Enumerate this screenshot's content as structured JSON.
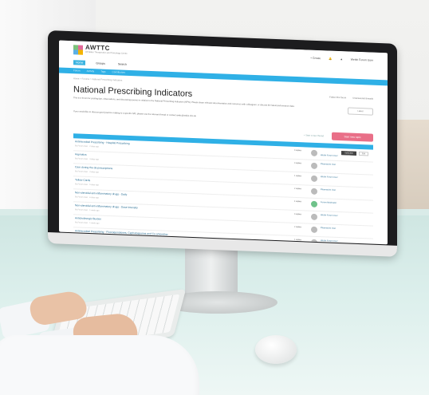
{
  "site": {
    "brand": "AWTTC",
    "brand_sub": "All Wales Therapeutics and Toxicology Centre",
    "nav": [
      "Home",
      "Groups",
      "Search"
    ],
    "header_right": [
      "+ Create",
      "Welsh Forum User"
    ],
    "subnav": [
      "Forum",
      "Activity",
      "Tags",
      "Contributors"
    ],
    "breadcrumb": "Home > Forums > National Prescribing Indicators",
    "page_title": "National Prescribing Indicators",
    "description": "This is a forum for posting tips, observations, and discussing queries in relation to the National Prescribing Indicators (NPIs). Please share relevant documentation and resources with colleagues, or discuss the latest performance data.",
    "description2": "If you would like to discuss good practice relating to a specific NPI, please use the relevant thread or contact awttc@wales.nhs.uk",
    "top_links": [
      "Follow this forum",
      "Unanswered threads"
    ],
    "sort_label": "Latest",
    "post_link": "+ Start a new thread",
    "start_button": "Start new topic",
    "threads": [
      {
        "title": "Antimicrobial Prescribing - Hospital Prescribing",
        "meta": "By Forum User · 2 days ago",
        "replies": "0 replies",
        "avatar": "grey",
        "user": "Welsh Forum User",
        "controls": [
          "Subscribe",
          "Edit"
        ]
      },
      {
        "title": "Hypnotics",
        "meta": "By Forum User · 3 days ago",
        "replies": "3 replies",
        "avatar": "grey",
        "user": "Pharmacist User"
      },
      {
        "title": "Care during the de-prescriptions",
        "meta": "By Forum User · 4 days ago",
        "replies": "1 replies",
        "avatar": "grey",
        "user": "Welsh Forum User"
      },
      {
        "title": "Yellow Cards",
        "meta": "By Forum User · 5 days ago",
        "replies": "2 replies",
        "avatar": "grey",
        "user": "Pharmacist User"
      },
      {
        "title": "Non-steroidal anti-inflammatory drugs - Daily",
        "meta": "By Forum User · 6 days ago",
        "replies": "4 replies",
        "avatar": "green",
        "user": "Forum Moderator"
      },
      {
        "title": "Non-steroidal anti-inflammatory drugs - Dose Intensity",
        "meta": "By Forum User · 1 week ago",
        "replies": "0 replies",
        "avatar": "grey",
        "user": "Welsh Forum User"
      },
      {
        "title": "Anticholinergic Burden",
        "meta": "By Forum User · 1 week ago",
        "replies": "2 replies",
        "avatar": "grey",
        "user": "Pharmacist User"
      },
      {
        "title": "Antimicrobial Prescribing - Fluoroquinolones, Cephalosporins and Co-amoxiclav",
        "meta": "By Forum User · 2 weeks ago",
        "replies": "1 replies",
        "avatar": "grey",
        "user": "Welsh Forum User"
      }
    ]
  }
}
